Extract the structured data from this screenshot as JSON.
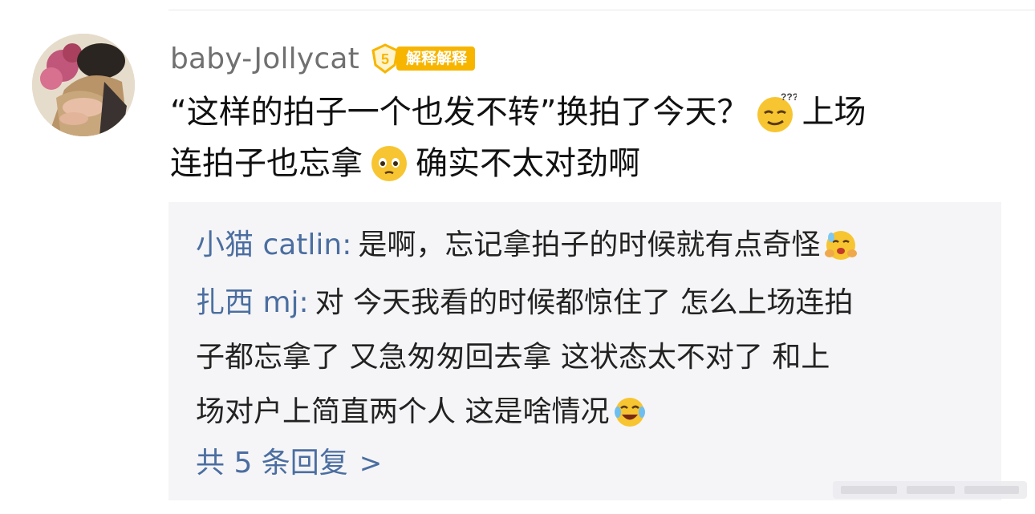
{
  "comment": {
    "username": "baby-Jollycat",
    "badge": {
      "level": "5",
      "label": "解释解释",
      "color": "#f7b500"
    },
    "text": {
      "line1a": "“这样的拍子一个也发不转”换拍了今天？",
      "emoji1": "smirk-sweat-emoji",
      "line1b": "上场",
      "line2a": "连拍子也忘拿",
      "emoji2": "worried-emoji",
      "line2b": "确实不太对劲啊"
    }
  },
  "replies": [
    {
      "author": "小猫 catlin",
      "separator": ":",
      "lines": [
        "是啊，忘记拿拍子的时候就有点奇怪"
      ],
      "trailing_emoji": "hug-face-emoji"
    },
    {
      "author": "扎西 mj",
      "separator": ":",
      "lines": [
        "对 今天我看的时候都惊住了 怎么上场连拍",
        "子都忘拿了 又急匆匆回去拿 这状态太不对了 和上",
        "场对户上简直两个人 这是啥情况"
      ],
      "trailing_emoji": "crying-laughing-emoji"
    }
  ],
  "more_replies": {
    "label": "共 5 条回复",
    "chevron": ">"
  },
  "colors": {
    "link": "#4b6ea0",
    "reply_bg": "#f5f5f7",
    "username": "#707070",
    "text": "#111111"
  }
}
